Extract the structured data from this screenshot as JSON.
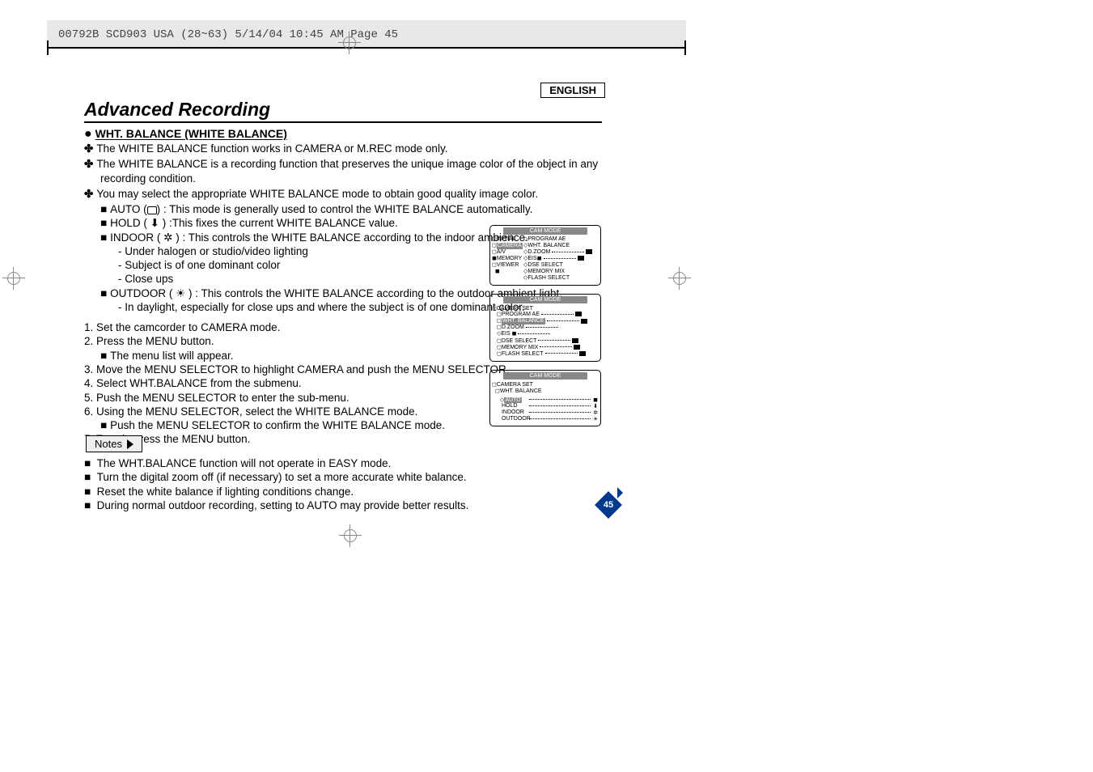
{
  "header_strip": "00792B SCD903 USA (28~63)  5/14/04 10:45 AM  Page 45",
  "lang": "ENGLISH",
  "title": "Advanced Recording",
  "section": "WHT. BALANCE (WHITE BALANCE)",
  "bullets": {
    "b1": "The WHITE BALANCE function works in CAMERA or M.REC mode only.",
    "b2": "The WHITE BALANCE is a recording function that preserves the unique image color of the object in any recording condition.",
    "b3": "You may select the appropriate WHITE BALANCE mode to obtain good quality image color.",
    "auto_pre": "AUTO (",
    "auto_post": ") : This mode is generally used to control the WHITE BALANCE automatically.",
    "hold": "HOLD ( ⬇ ) :This fixes the current WHITE BALANCE value.",
    "indoor": "INDOOR ( ✲ ) : This controls the WHITE BALANCE according to the indoor ambience.",
    "in1": "-   Under halogen or studio/video lighting",
    "in2": "-   Subject is of one dominant color",
    "in3": "-   Close ups",
    "outdoor": "OUTDOOR ( ☀ ) : This controls the WHITE BALANCE according to the outdoor ambient light.",
    "out1": "-   In daylight, especially for close ups and where the subject is of one dominant color."
  },
  "steps": {
    "s1": "1.  Set the camcorder to CAMERA mode.",
    "s2": "2.  Press the MENU button.",
    "s2a": "The menu list will appear.",
    "s3": "3.  Move the MENU SELECTOR to highlight CAMERA and push the MENU SELECTOR.",
    "s4": "4.  Select WHT.BALANCE from the submenu.",
    "s5": "5.  Push the MENU SELECTOR to enter the sub-menu.",
    "s6": "6.  Using the MENU SELECTOR, select the WHITE BALANCE mode.",
    "s6a": "Push the MENU SELECTOR to confirm the WHITE BALANCE mode.",
    "s7": "7.  To exit, press the MENU button."
  },
  "notes_label": "Notes",
  "notes": {
    "n1": "The WHT.BALANCE function will not operate in EASY mode.",
    "n2": "Turn the digital zoom off (if necessary) to set a more accurate white balance.",
    "n3": "Reset the white balance if lighting conditions change.",
    "n4": "During normal outdoor recording, setting to AUTO may provide better results."
  },
  "menus": {
    "cap": "CAM  MODE",
    "scr1_left": [
      "INITIAL",
      "CAMERA",
      "A/V",
      "MEMORY",
      "VIEWER"
    ],
    "scr1_right": [
      "PROGRAM AE",
      "WHT. BALANCE",
      "D.ZOOM",
      "EIS",
      "DSE SELECT",
      "MEMORY MIX",
      "FLASH SELECT"
    ],
    "scr2_head": "CAMERA SET",
    "scr2_list": [
      "PROGRAM AE",
      "WHT. BALANCE",
      "D.ZOOM",
      "EIS",
      "DSE SELECT",
      "MEMORY MIX",
      "FLASH SELECT"
    ],
    "scr3_head1": "CAMERA SET",
    "scr3_head2": "WHT. BALANCE",
    "scr3_opts": [
      "AUTO",
      "HOLD",
      "INDOOR",
      "OUTDOOR"
    ]
  },
  "page_number": "45"
}
